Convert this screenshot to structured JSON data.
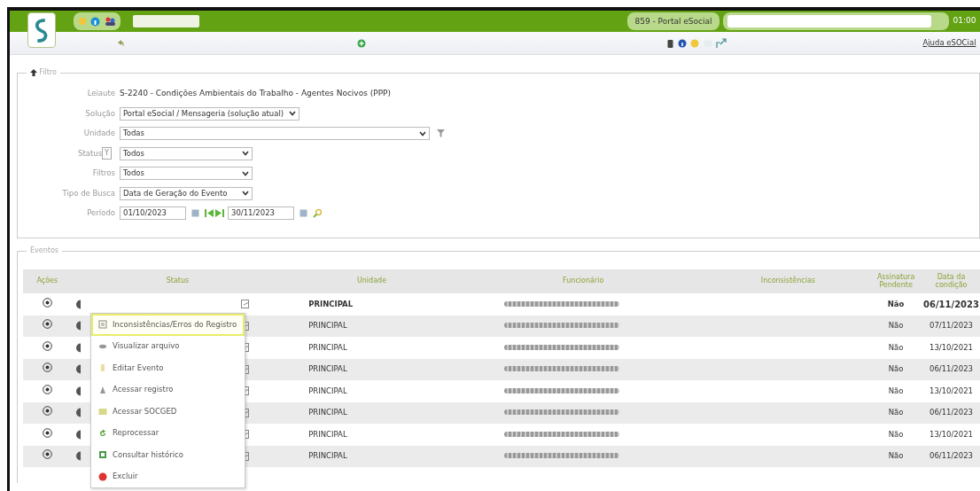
{
  "header": {
    "system": "859 - Portal eSocial",
    "time": "01:00"
  },
  "toolbar": {
    "help_link": "Ajuda eSOCial"
  },
  "filters": {
    "legend": "Filtro",
    "fields": [
      {
        "kind": "text",
        "label": "Leiaute",
        "value": "S-2240 - Condições Ambientais do Trabalho - Agentes Nocivos (PPP)"
      },
      {
        "kind": "select",
        "label": "Solução",
        "value": "Portal eSocial / Mensageria (solução atual)"
      },
      {
        "kind": "select",
        "label": "Unidade",
        "value": "Todas",
        "filter_button": true
      },
      {
        "kind": "select",
        "label": "Status",
        "value": "Todos",
        "tag": "Y"
      },
      {
        "kind": "select",
        "label": "Filtros",
        "value": "Todos"
      },
      {
        "kind": "select",
        "label": "Tipo de Busca",
        "value": "Data de Geração do Evento"
      },
      {
        "kind": "period",
        "label": "Período",
        "from": "01/10/2023",
        "to": "30/11/2023"
      }
    ]
  },
  "events": {
    "legend": "Eventos",
    "columns": [
      "Ações",
      "Status",
      "Unidade",
      "Funcionário",
      "Inconsistências",
      "Assinatura Pendente",
      "Data da condição"
    ],
    "rows": [
      {
        "selected": true,
        "unit": "PRINCIPAL",
        "signature": "Não",
        "date": "06/11/2023"
      },
      {
        "selected": false,
        "unit": "PRINCIPAL",
        "signature": "Não",
        "date": "07/11/2023"
      },
      {
        "selected": false,
        "unit": "PRINCIPAL",
        "signature": "Não",
        "date": "13/10/2021"
      },
      {
        "selected": false,
        "unit": "PRINCIPAL",
        "signature": "Não",
        "date": "06/11/2023"
      },
      {
        "selected": false,
        "unit": "PRINCIPAL",
        "signature": "Não",
        "date": "13/10/2021"
      },
      {
        "selected": false,
        "unit": "PRINCIPAL",
        "signature": "Não",
        "date": "06/11/2023"
      },
      {
        "selected": false,
        "unit": "PRINCIPAL",
        "signature": "Não",
        "date": "13/10/2021"
      },
      {
        "selected": false,
        "unit": "PRINCIPAL",
        "signature": "Não",
        "date": "06/11/2023"
      }
    ]
  },
  "context_menu": {
    "items": [
      {
        "kind": "errors",
        "label": "Inconsistências/Erros do Registro",
        "selected": true
      },
      {
        "kind": "view",
        "label": "Visualizar arquivo",
        "selected": false
      },
      {
        "kind": "edit",
        "label": "Editar Evento",
        "selected": false
      },
      {
        "kind": "access",
        "label": "Acessar registro",
        "selected": false
      },
      {
        "kind": "folder",
        "label": "Acessar SOCGED",
        "selected": false
      },
      {
        "kind": "reprocess",
        "label": "Reprocessar",
        "selected": false
      },
      {
        "kind": "history",
        "label": "Consultar histórico",
        "selected": false
      },
      {
        "kind": "delete",
        "label": "Excluir",
        "selected": false
      }
    ]
  }
}
